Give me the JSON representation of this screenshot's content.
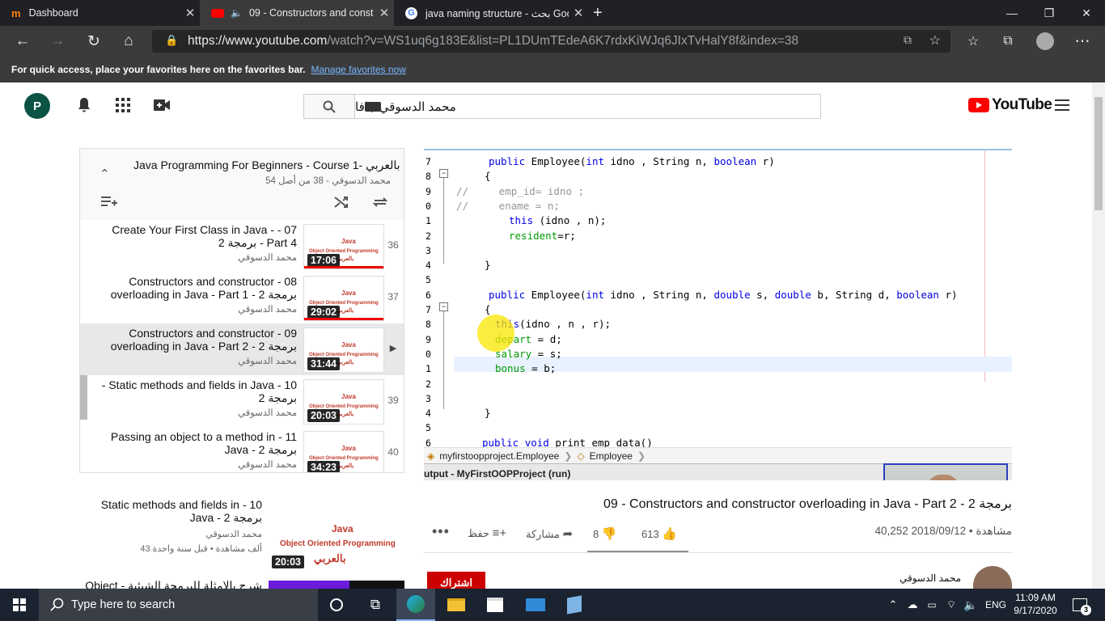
{
  "tabs": [
    {
      "label": "Dashboard",
      "icon": "moodle-icon"
    },
    {
      "label": "09 - Constructors and const",
      "icon": "youtube-icon"
    },
    {
      "label": "java naming structure - بحث Goo",
      "icon": "google-icon"
    }
  ],
  "url": {
    "base": "https://www.youtube.com",
    "path": "/watch?v=WS1uq6g183E&list=PL1DUmTEdeA6K7rdxKiWJq6JIxTvHalY8f&index=38"
  },
  "favorites_bar": {
    "text": "For quick access, place your favorites here on the favorites bar.",
    "link": "Manage favorites now"
  },
  "youtube": {
    "avatar": "P",
    "search_query": "محمد الدسوقي جافا",
    "logo": "YouTube"
  },
  "playlist": {
    "title": "Java Programming For Beginners - Course 1- بالعربي",
    "subtitle": "محمد الدسوقي - 38 من أصل 54",
    "items": [
      {
        "title": "Create Your First Class in Java - - 07 برمجة 2 - Part 4",
        "channel": "محمد الدسوقي",
        "duration": "17:06",
        "index": "36",
        "watched": true
      },
      {
        "title": "Constructors and constructor - 08 overloading in Java - Part 1 - برمجة 2",
        "channel": "محمد الدسوقي",
        "duration": "29:02",
        "index": "37",
        "watched": true
      },
      {
        "title": "Constructors and constructor - 09 overloading in Java - Part 2 - برمجة 2",
        "channel": "محمد الدسوقي",
        "duration": "31:44",
        "index": "▶",
        "watched": false
      },
      {
        "title": "- Static methods and fields in Java - 10 برمجة 2",
        "channel": "محمد الدسوقي",
        "duration": "20:03",
        "index": "39",
        "watched": false
      },
      {
        "title": "Passing an object to a method in - 11 Java - برمجة 2",
        "channel": "محمد الدسوقي",
        "duration": "34:23",
        "index": "40",
        "watched": false
      }
    ]
  },
  "recommended": [
    {
      "title": "Static methods and fields in - 10 Java - برمجة 2",
      "channel": "محمد الدسوقي",
      "meta": "43 ألف مشاهدة • قبل سنة واحدة",
      "duration": "20:03"
    },
    {
      "title": "شرح بالامثلة للبرمجة الشيئية - Object",
      "channel": "",
      "meta": "",
      "duration": ""
    }
  ],
  "thumbnail_text": {
    "java": "Java",
    "oop": "Object Oriented Programming",
    "arabic": "بالعربي"
  },
  "video": {
    "title": "09 - Constructors and constructor overloading in Java - Part 2 - 2 برمجة",
    "views": "40,252 مشاهدة • 2018/09/12",
    "likes": "613",
    "dislikes": "8",
    "share": "مشاركة",
    "save": "حفظ",
    "channel": "محمد الدسوقي",
    "subscribe": "اشتراك"
  },
  "code_lines": [
    {
      "n": "7",
      "text": "public Employee(int idno , String n, boolean r)"
    },
    {
      "n": "8",
      "text": "{"
    },
    {
      "n": "9",
      "text": "//     emp_id= idno ;"
    },
    {
      "n": "0",
      "text": "//     ename = n;"
    },
    {
      "n": "1",
      "text": "this (idno , n);"
    },
    {
      "n": "2",
      "text": "resident=r;"
    },
    {
      "n": "3",
      "text": ""
    },
    {
      "n": "4",
      "text": "}"
    },
    {
      "n": "5",
      "text": ""
    },
    {
      "n": "6",
      "text": "public Employee(int idno , String n, double s, double b, String d, boolean r)"
    },
    {
      "n": "7",
      "text": "{"
    },
    {
      "n": "8",
      "text": "this(idno , n , r);"
    },
    {
      "n": "9",
      "text": "depart = d;"
    },
    {
      "n": "0",
      "text": "salary = s;"
    },
    {
      "n": "1",
      "text": "bonus = b;"
    },
    {
      "n": "2",
      "text": ""
    },
    {
      "n": "3",
      "text": ""
    },
    {
      "n": "4",
      "text": "}"
    },
    {
      "n": "5",
      "text": ""
    },
    {
      "n": "6",
      "text": "public void print_emp_data()"
    }
  ],
  "ide": {
    "breadcrumb_pkg": "myfirstoopproject.Employee",
    "breadcrumb_cls": "Employee",
    "output_tab": "utput - MyFirstOOPProject (run)"
  },
  "taskbar": {
    "search_placeholder": "Type here to search",
    "time": "11:09 AM",
    "date": "9/17/2020",
    "lang": "ENG",
    "notifications": "3"
  }
}
